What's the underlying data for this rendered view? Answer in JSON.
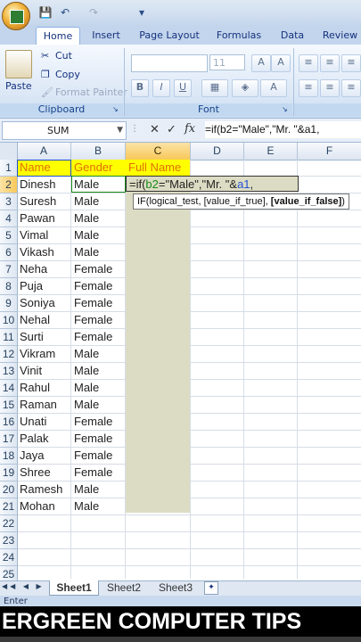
{
  "quick_access": {
    "save": "💾",
    "undo": "↶",
    "redo": "↷",
    "dropdown": "▾"
  },
  "tabs": [
    "Home",
    "Insert",
    "Page Layout",
    "Formulas",
    "Data",
    "Review"
  ],
  "ribbon": {
    "clipboard": {
      "paste": "Paste",
      "cut": "Cut",
      "copy": "Copy",
      "format_painter": "Format Painter",
      "label": "Clipboard"
    },
    "font": {
      "size": "11",
      "label": "Font",
      "bold": "B",
      "italic": "I",
      "underline": "U"
    }
  },
  "formula_bar": {
    "name_box": "SUM",
    "fx": "fx",
    "cancel": "✕",
    "enter": "✓",
    "formula": "=if(b2=\"Male\",\"Mr. \"&a1,"
  },
  "columns": [
    "A",
    "B",
    "C",
    "D",
    "E",
    "F"
  ],
  "rows": [
    "1",
    "2",
    "3",
    "4",
    "5",
    "6",
    "7",
    "8",
    "9",
    "10",
    "11",
    "12",
    "13",
    "14",
    "15",
    "16",
    "17",
    "18",
    "19",
    "20",
    "21",
    "22",
    "23",
    "24",
    "25"
  ],
  "headers": {
    "name": "Name",
    "gender": "Gender",
    "full_name": "Full Name"
  },
  "data_rows": [
    {
      "name": "Dinesh",
      "gender": "Male"
    },
    {
      "name": "Suresh",
      "gender": "Male"
    },
    {
      "name": "Pawan",
      "gender": "Male"
    },
    {
      "name": "Vimal",
      "gender": "Male"
    },
    {
      "name": "Vikash",
      "gender": "Male"
    },
    {
      "name": "Neha",
      "gender": "Female"
    },
    {
      "name": "Puja",
      "gender": "Female"
    },
    {
      "name": "Soniya",
      "gender": "Female"
    },
    {
      "name": "Nehal",
      "gender": "Female"
    },
    {
      "name": "Surti",
      "gender": "Female"
    },
    {
      "name": "Vikram",
      "gender": "Male"
    },
    {
      "name": "Vinit",
      "gender": "Male"
    },
    {
      "name": "Rahul",
      "gender": "Male"
    },
    {
      "name": "Raman",
      "gender": "Male"
    },
    {
      "name": "Unati",
      "gender": "Female"
    },
    {
      "name": "Palak",
      "gender": "Female"
    },
    {
      "name": "Jaya",
      "gender": "Female"
    },
    {
      "name": "Shree",
      "gender": "Female"
    },
    {
      "name": "Ramesh",
      "gender": "Male"
    },
    {
      "name": "Mohan",
      "gender": "Male"
    }
  ],
  "edit_cell": {
    "prefix": "=if(",
    "ref1": "b2",
    "mid": "=\"Male\",\"Mr. \"&",
    "ref2": "a1",
    "suffix": ","
  },
  "tooltip": {
    "prefix": "IF(logical_test, [value_if_true], ",
    "bold": "[value_if_false]",
    "suffix": ")"
  },
  "sheets": [
    "Sheet1",
    "Sheet2",
    "Sheet3"
  ],
  "status": "Enter",
  "banner": "ERGREEN COMPUTER TIPS",
  "colors": {
    "header_fill": "#ffff00",
    "header_text": "#e07000",
    "selection_fill": "#dcdcc4",
    "ref_blue": "#1f4fd1",
    "ref_green": "#1a8a1a"
  }
}
